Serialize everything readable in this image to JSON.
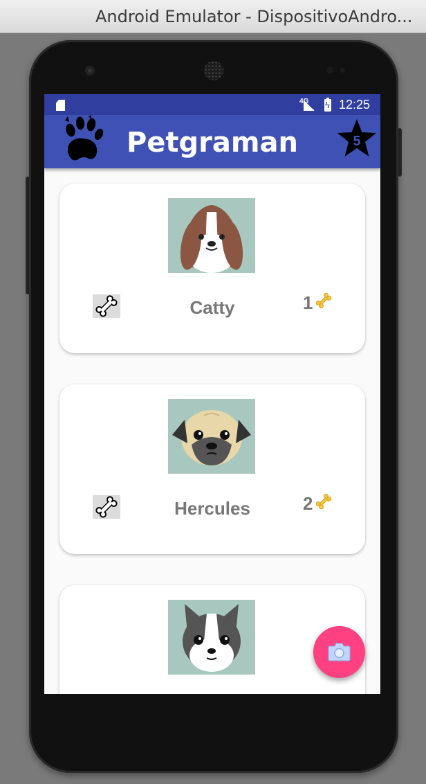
{
  "window": {
    "title": "Android Emulator - DispositivoAndro..."
  },
  "statusbar": {
    "network": "4G",
    "battery_glyph": "ϟ",
    "time": "12:25"
  },
  "appbar": {
    "title": "Petgraman",
    "paw_icon": "paw-icon",
    "star_count": "5"
  },
  "pets": [
    {
      "name": "Catty",
      "likes": "1",
      "face": "beagle"
    },
    {
      "name": "Hercules",
      "likes": "2",
      "face": "pug"
    },
    {
      "name": "",
      "likes": "",
      "face": "bulldog"
    }
  ],
  "colors": {
    "primary": "#3f51b5",
    "primary_dark": "#303f9f",
    "accent": "#ff4081",
    "pet_image_bg": "#a8c8bf",
    "text_gray": "#777777"
  },
  "fab": {
    "icon": "camera-icon"
  }
}
